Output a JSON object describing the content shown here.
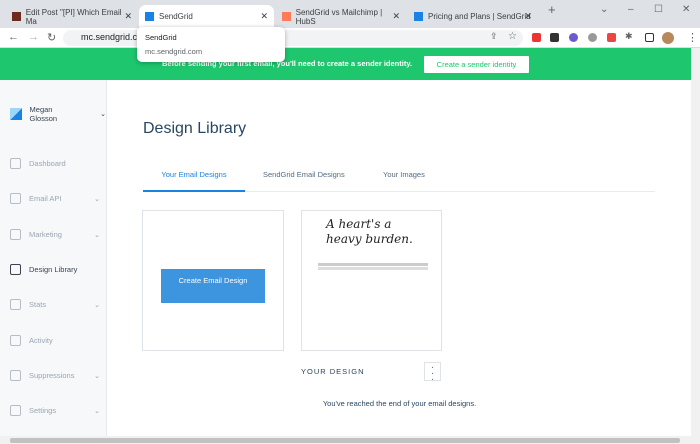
{
  "browser": {
    "tabs": [
      {
        "title": "Edit Post \"[PI] Which Email Ma",
        "color": "#6d2b1f"
      },
      {
        "title": "SendGrid",
        "color": "#1a82e2"
      },
      {
        "title": "SendGrid vs Mailchimp | HubS",
        "color": "#ff7a59"
      },
      {
        "title": "Pricing and Plans | SendGrid",
        "color": "#1a82e2"
      }
    ],
    "url": "mc.sendgrid.com",
    "popup": {
      "title": "SendGrid",
      "url": "mc.sendgrid.com"
    }
  },
  "banner": {
    "message": "Before sending your first email, you'll need to create a sender identity.",
    "button": "Create a sender identity"
  },
  "sidebar": {
    "user": "Megan Glosson",
    "items": [
      {
        "label": "Dashboard"
      },
      {
        "label": "Email API"
      },
      {
        "label": "Marketing"
      },
      {
        "label": "Design Library"
      },
      {
        "label": "Stats"
      },
      {
        "label": "Activity"
      },
      {
        "label": "Suppressions"
      },
      {
        "label": "Settings"
      }
    ]
  },
  "main": {
    "title": "Design Library",
    "tabs": [
      "Your Email Designs",
      "SendGrid Email Designs",
      "Your Images"
    ],
    "create_button": "Create Email Design",
    "preview_text": "A heart's a heavy burden.",
    "design_name": "YOUR DESIGN",
    "end_message": "You've reached the end of your email designs."
  }
}
